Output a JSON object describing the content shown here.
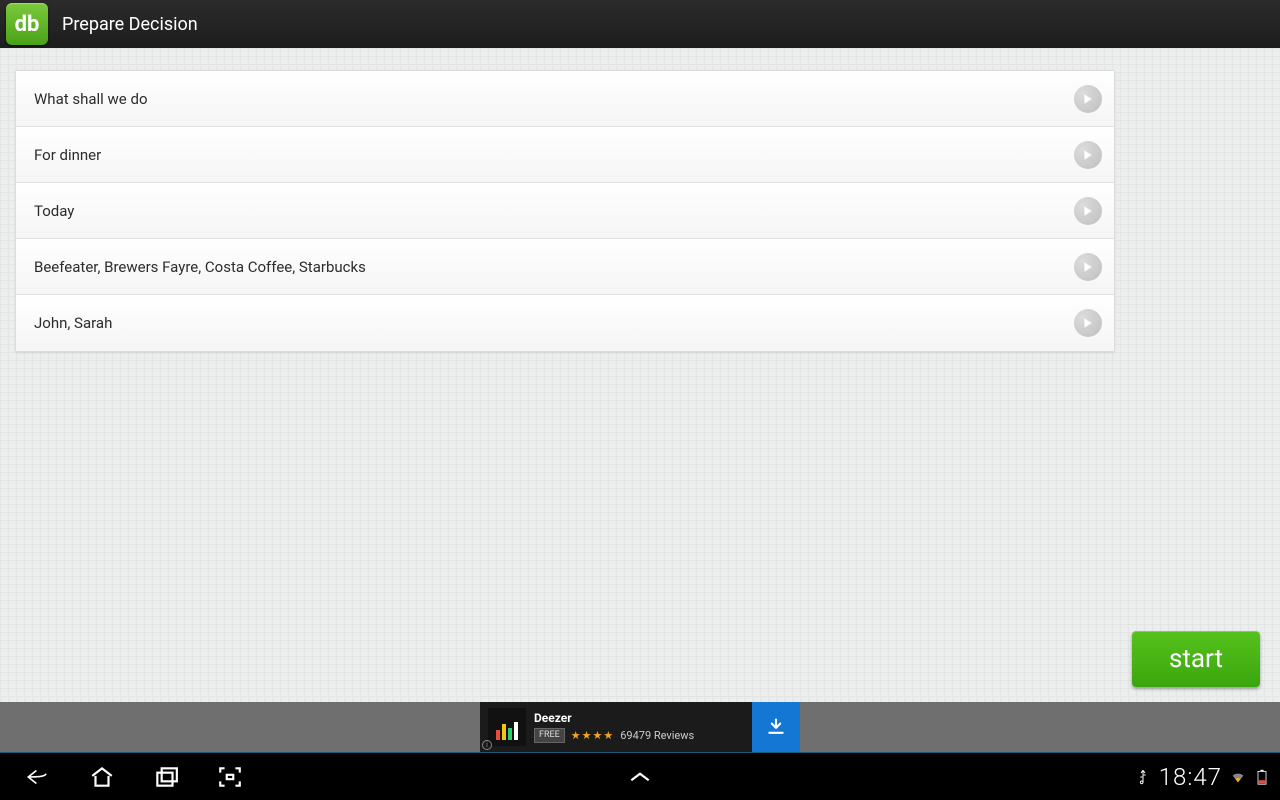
{
  "header": {
    "app_icon_text": "db",
    "title": "Prepare Decision"
  },
  "list": {
    "items": [
      {
        "label": "What shall we do"
      },
      {
        "label": "For dinner"
      },
      {
        "label": "Today"
      },
      {
        "label": "Beefeater, Brewers Fayre, Costa Coffee, Starbucks"
      },
      {
        "label": "John, Sarah"
      }
    ]
  },
  "start_button": {
    "label": "start"
  },
  "ad": {
    "title": "Deezer",
    "badge": "FREE",
    "stars": "★★★★",
    "reviews": "69479 Reviews"
  },
  "statusbar": {
    "time": "18:47"
  }
}
